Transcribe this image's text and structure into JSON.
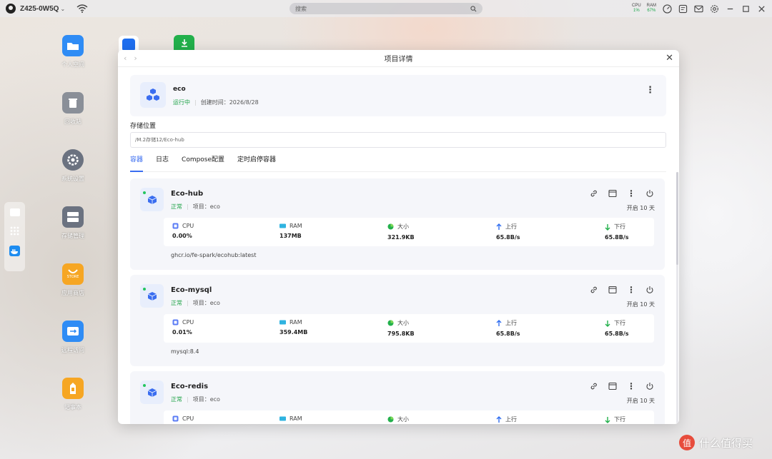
{
  "topbar": {
    "hostname": "Z425-0W5Q",
    "search_placeholder": "搜索",
    "cpu_label": "CPU",
    "cpu_value": "1%",
    "ram_label": "RAM",
    "ram_value": "67%"
  },
  "desktop": {
    "icons": [
      {
        "label": "个人空间",
        "icon": "folder-icon",
        "color": "#2f8cf5"
      },
      {
        "label": "回收站",
        "icon": "trash-icon",
        "color": "#8a8f98"
      },
      {
        "label": "系统设置",
        "icon": "gear-icon",
        "color": "#6b7280"
      },
      {
        "label": "存储管理",
        "icon": "server-icon",
        "color": "#6b7280"
      },
      {
        "label": "应用商店",
        "icon": "store-icon",
        "color": "#f6a623"
      },
      {
        "label": "远程访问",
        "icon": "remote-icon",
        "color": "#2f8cf5"
      },
      {
        "label": "记事本",
        "icon": "notes-icon",
        "color": "#f6a623"
      }
    ],
    "store_tile_text": "STORE"
  },
  "window": {
    "title": "项目详情",
    "project": {
      "name": "eco",
      "status": "运行中",
      "created": "创建时间：2026/8/28"
    },
    "storage_label": "存储位置",
    "storage_path": "/M.2存储12/Eco-hub",
    "tabs": [
      "容器",
      "日志",
      "Compose配置",
      "定时启停容器"
    ],
    "active_tab": 0
  },
  "labels": {
    "cpu": "CPU",
    "ram": "RAM",
    "size": "大小",
    "up": "上行",
    "down": "下行"
  },
  "containers": [
    {
      "name": "Eco-hub",
      "status": "正常",
      "project": "项目：eco",
      "uptime": "开启 10 天",
      "cpu": "0.00%",
      "ram": "137MB",
      "size": "321.9KB",
      "up": "65.8B/s",
      "down": "65.8B/s",
      "image": "ghcr.io/fe-spark/ecohub:latest"
    },
    {
      "name": "Eco-mysql",
      "status": "正常",
      "project": "项目：eco",
      "uptime": "开启 10 天",
      "cpu": "0.01%",
      "ram": "359.4MB",
      "size": "795.8KB",
      "up": "65.8B/s",
      "down": "65.8B/s",
      "image": "mysql:8.4"
    },
    {
      "name": "Eco-redis",
      "status": "正常",
      "project": "项目：eco",
      "uptime": "开启 10 天"
    }
  ],
  "watermark": {
    "logo_char": "值",
    "text": "什么值得买"
  },
  "colors": {
    "accent": "#3a6df0",
    "running": "#22a44a"
  }
}
